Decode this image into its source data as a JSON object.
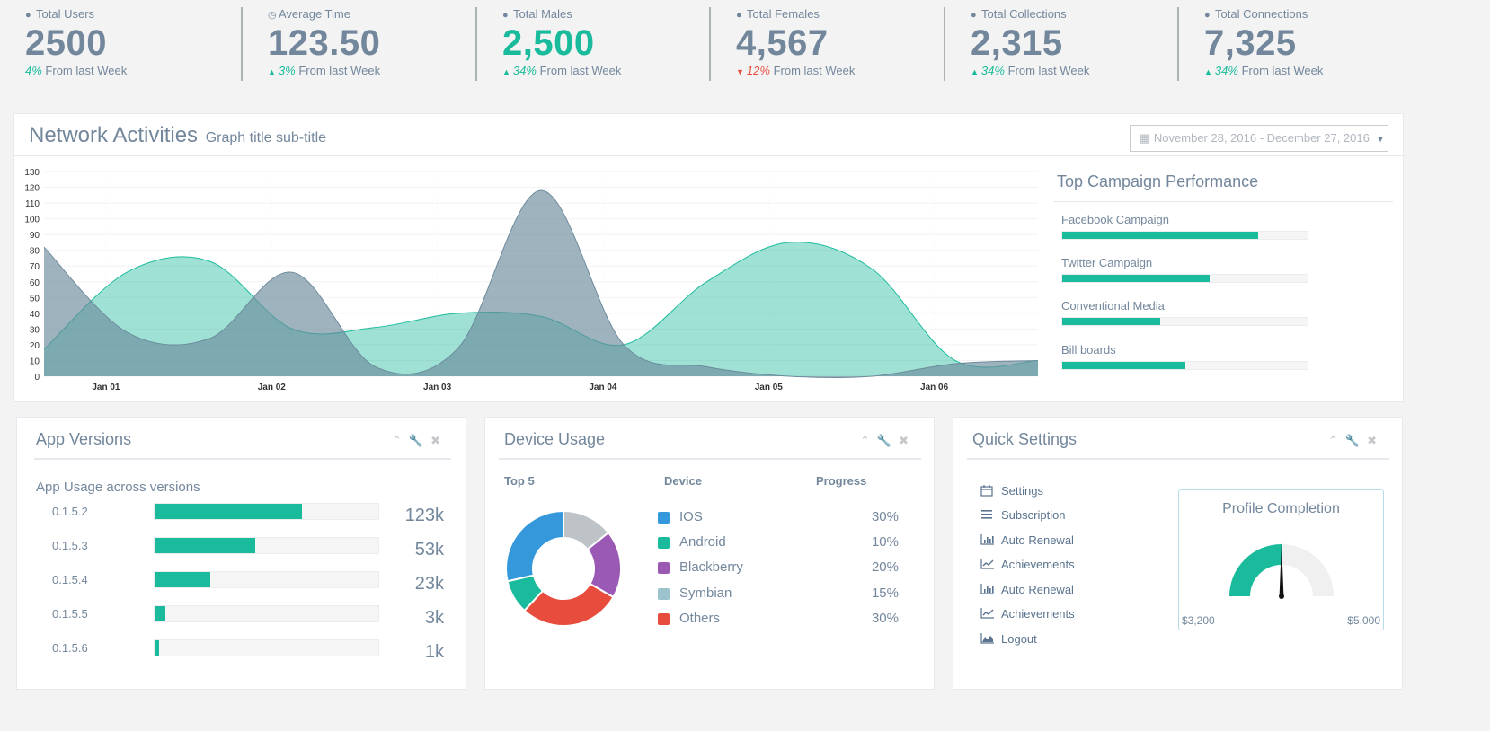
{
  "stats": [
    {
      "icon": "user-icon",
      "title": "Total Users",
      "count": "2500",
      "count_color": "#73879c",
      "pct": "4%",
      "pct_dir": "none",
      "suffix": "From last Week"
    },
    {
      "icon": "clock-icon",
      "title": "Average Time",
      "count": "123.50",
      "count_color": "#73879c",
      "pct": "3%",
      "pct_dir": "up",
      "suffix": "From last Week"
    },
    {
      "icon": "user-icon",
      "title": "Total Males",
      "count": "2,500",
      "count_color": "#1abb9c",
      "pct": "34%",
      "pct_dir": "up",
      "suffix": "From last Week"
    },
    {
      "icon": "user-icon",
      "title": "Total Females",
      "count": "4,567",
      "count_color": "#73879c",
      "pct": "12%",
      "pct_dir": "down",
      "suffix": "From last Week"
    },
    {
      "icon": "user-icon",
      "title": "Total Collections",
      "count": "2,315",
      "count_color": "#73879c",
      "pct": "34%",
      "pct_dir": "up",
      "suffix": "From last Week"
    },
    {
      "icon": "user-icon",
      "title": "Total Connections",
      "count": "7,325",
      "count_color": "#73879c",
      "pct": "34%",
      "pct_dir": "up",
      "suffix": "From last Week"
    }
  ],
  "network": {
    "title": "Network Activities",
    "subtitle": "Graph title sub-title",
    "date_range": "November 28, 2016 - December 27, 2016"
  },
  "chart_data": {
    "type": "area",
    "title": "",
    "xlabel": "",
    "ylabel": "",
    "ylim": [
      0,
      130
    ],
    "yticks": [
      0,
      10,
      20,
      30,
      40,
      50,
      60,
      70,
      80,
      90,
      100,
      110,
      120,
      130
    ],
    "x_tick_labels": [
      "Jan 01",
      "Jan 02",
      "Jan 03",
      "Jan 04",
      "Jan 05",
      "Jan 06"
    ],
    "x": [
      0.0,
      0.5,
      1.0,
      1.5,
      2.0,
      2.5,
      3.0,
      3.5,
      4.0,
      4.5,
      5.0,
      5.5,
      6.0
    ],
    "grid": true,
    "legend": "none",
    "series": [
      {
        "color": "#1abb9c",
        "values": [
          17,
          66,
          73,
          30,
          31,
          40,
          38,
          20,
          60,
          85,
          68,
          10,
          10
        ]
      },
      {
        "color": "#6c8b9c",
        "values": [
          82,
          28,
          24,
          66,
          6,
          18,
          118,
          20,
          6,
          0,
          0,
          8,
          10
        ]
      }
    ]
  },
  "campaigns": {
    "title": "Top Campaign Performance",
    "items": [
      {
        "label": "Facebook Campaign",
        "value": 80
      },
      {
        "label": "Twitter Campaign",
        "value": 60
      },
      {
        "label": "Conventional Media",
        "value": 40
      },
      {
        "label": "Bill boards",
        "value": 50
      }
    ]
  },
  "app_versions": {
    "title": "App Versions",
    "subtitle": "App Usage across versions",
    "items": [
      {
        "version": "0.1.5.2",
        "percent": 66,
        "value": "123k"
      },
      {
        "version": "0.1.5.3",
        "percent": 45,
        "value": "53k"
      },
      {
        "version": "0.1.5.4",
        "percent": 25,
        "value": "23k"
      },
      {
        "version": "0.1.5.5",
        "percent": 5,
        "value": "3k"
      },
      {
        "version": "0.1.5.6",
        "percent": 2,
        "value": "1k"
      }
    ]
  },
  "device_usage": {
    "title": "Device Usage",
    "col_top": "Top 5",
    "col_device": "Device",
    "col_progress": "Progress",
    "items": [
      {
        "name": "IOS",
        "pct": "30%",
        "color": "#3498db",
        "slice": 30
      },
      {
        "name": "Android",
        "pct": "10%",
        "color": "#1abb9c",
        "slice": 10
      },
      {
        "name": "Blackberry",
        "pct": "20%",
        "color": "#9b59b6",
        "slice": 20
      },
      {
        "name": "Symbian",
        "pct": "15%",
        "color": "#9cc2cb",
        "slice": 15
      },
      {
        "name": "Others",
        "pct": "30%",
        "color": "#e74c3c",
        "slice": 30
      }
    ],
    "donut_order": [
      {
        "color": "#bdc3c7",
        "value": 15
      },
      {
        "color": "#9b59b6",
        "value": 20
      },
      {
        "color": "#e74c3c",
        "value": 30
      },
      {
        "color": "#1abb9c",
        "value": 10
      },
      {
        "color": "#3498db",
        "value": 30
      }
    ]
  },
  "quick_settings": {
    "title": "Quick Settings",
    "items": [
      {
        "label": "Settings",
        "icon": "calendar-icon"
      },
      {
        "label": "Subscription",
        "icon": "bars-icon"
      },
      {
        "label": "Auto Renewal",
        "icon": "bar-chart-icon"
      },
      {
        "label": "Achievements",
        "icon": "line-chart-icon"
      },
      {
        "label": "Auto Renewal",
        "icon": "bar-chart-icon"
      },
      {
        "label": "Achievements",
        "icon": "line-chart-icon"
      },
      {
        "label": "Logout",
        "icon": "area-chart-icon"
      }
    ],
    "profile": {
      "title": "Profile Completion",
      "min": "$3,200",
      "max": "$5,000",
      "fraction": 0.5
    }
  },
  "colors": {
    "accent": "#1abb9c",
    "text": "#73879c",
    "danger": "#e74c3c"
  }
}
